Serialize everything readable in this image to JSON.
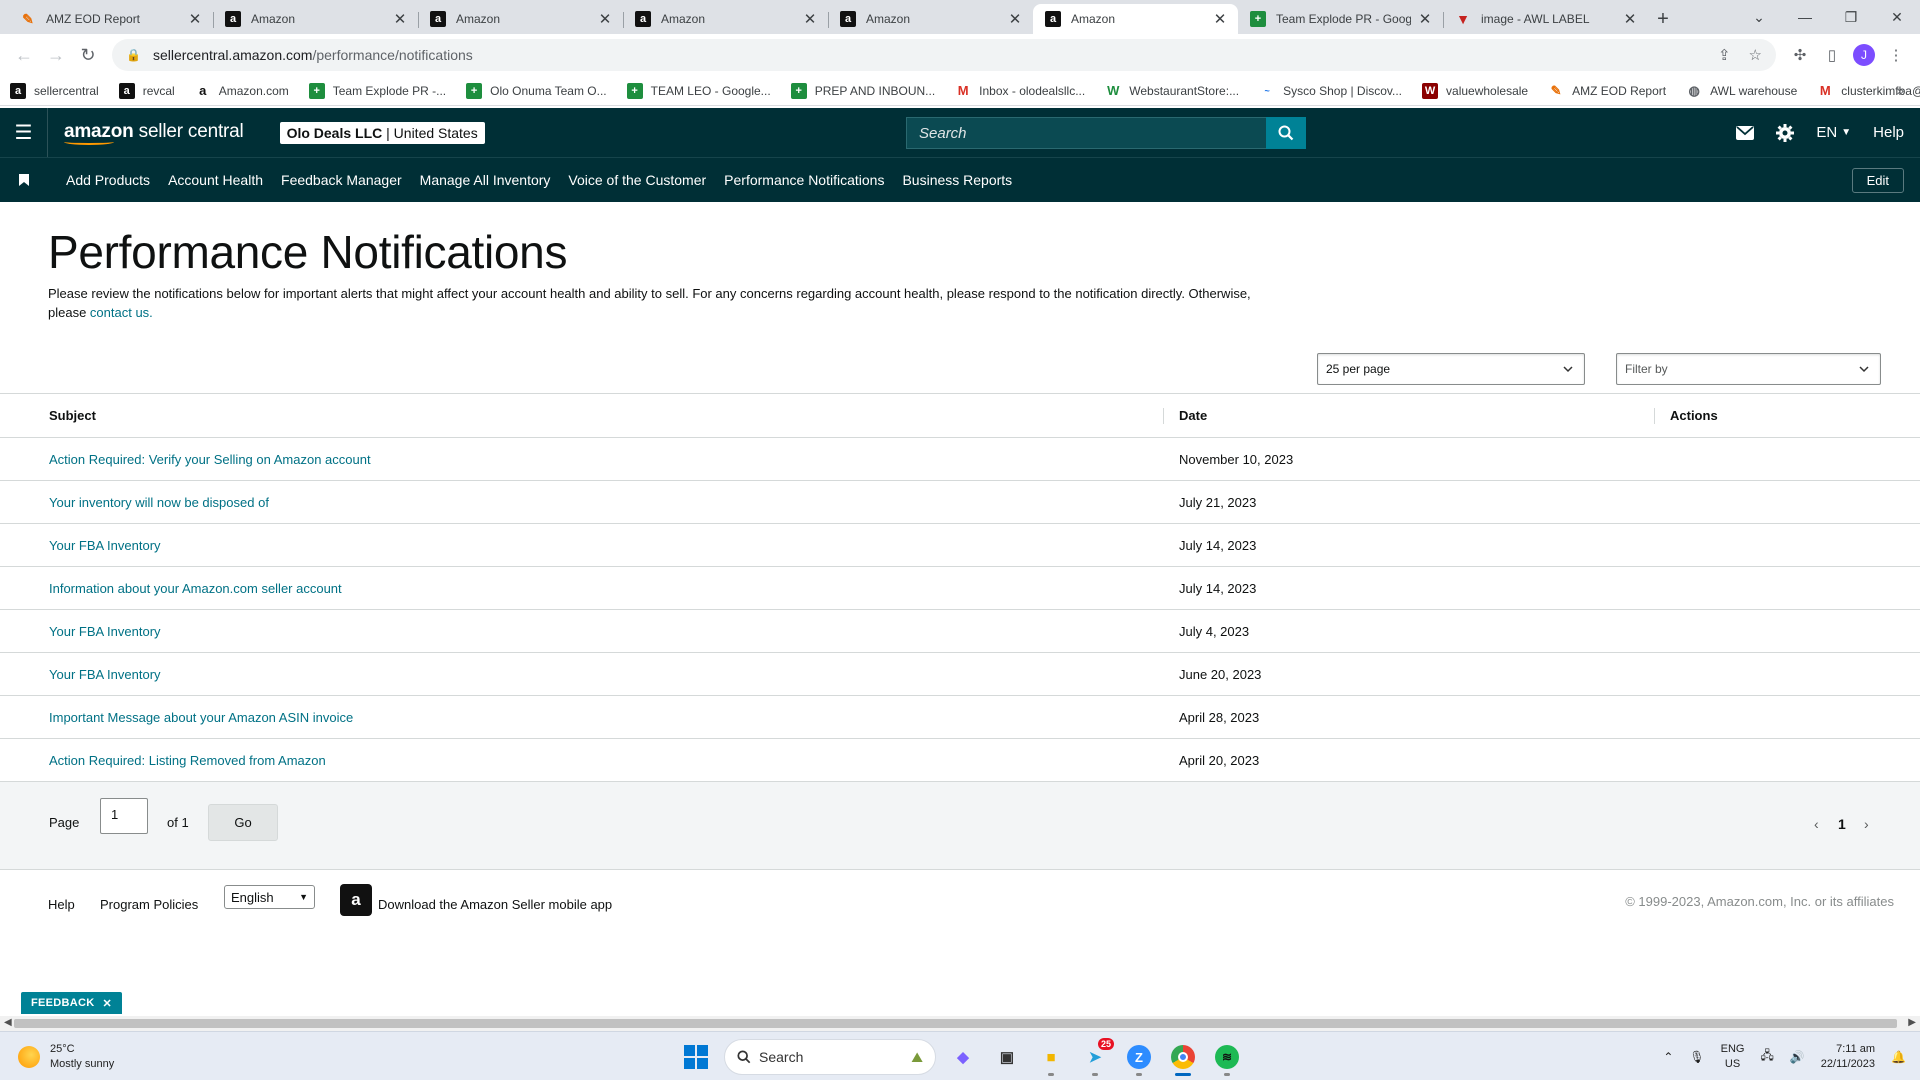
{
  "browser": {
    "tabs": [
      {
        "title": "AMZ EOD Report",
        "icon": "claude-icon",
        "active": false
      },
      {
        "title": "Amazon",
        "icon": "amazon-icon",
        "active": false
      },
      {
        "title": "Amazon",
        "icon": "amazon-icon",
        "active": false
      },
      {
        "title": "Amazon",
        "icon": "amazon-icon",
        "active": false
      },
      {
        "title": "Amazon",
        "icon": "amazon-icon",
        "active": false
      },
      {
        "title": "Amazon",
        "icon": "amazon-icon",
        "active": true
      },
      {
        "title": "Team Explode PR - Googl",
        "icon": "sheets-icon",
        "active": false
      },
      {
        "title": "image - AWL LABEL",
        "icon": "dogs-icon",
        "active": false
      }
    ],
    "url_host": "sellercentral.amazon.com",
    "url_path": "/performance/notifications",
    "profile_initial": "J",
    "bookmarks": [
      {
        "label": "sellercentral",
        "icon": "amazon-icon"
      },
      {
        "label": "revcal",
        "icon": "amazon-icon"
      },
      {
        "label": "Amazon.com",
        "icon": "amazon-smile-icon"
      },
      {
        "label": "Team Explode PR -...",
        "icon": "sheets-icon"
      },
      {
        "label": "Olo Onuma Team O...",
        "icon": "sheets-icon"
      },
      {
        "label": "TEAM LEO - Google...",
        "icon": "sheets-icon"
      },
      {
        "label": "PREP AND INBOUN...",
        "icon": "sheets-icon"
      },
      {
        "label": "Inbox - olodealsllc...",
        "icon": "gmail-icon"
      },
      {
        "label": "WebstaurantStore:...",
        "icon": "webstaurant-icon"
      },
      {
        "label": "Sysco Shop | Discov...",
        "icon": "sysco-icon"
      },
      {
        "label": "valuewholesale",
        "icon": "valuewholesale-icon"
      },
      {
        "label": "AMZ EOD Report",
        "icon": "claude-icon"
      },
      {
        "label": "AWL warehouse",
        "icon": "globe-icon"
      },
      {
        "label": "clusterkimfba@gm...",
        "icon": "gmail-icon"
      }
    ]
  },
  "header": {
    "logo_brand": "amazon",
    "logo_product": "seller central",
    "account_name": "Olo Deals LLC",
    "account_marketplace": "United States",
    "search_placeholder": "Search",
    "language": "EN",
    "help": "Help"
  },
  "nav": {
    "items": [
      "Add Products",
      "Account Health",
      "Feedback Manager",
      "Manage All Inventory",
      "Voice of the Customer",
      "Performance Notifications",
      "Business Reports"
    ],
    "edit_label": "Edit"
  },
  "page": {
    "title": "Performance Notifications",
    "description": "Please review the notifications below for important alerts that might affect your account health and ability to sell. For any concerns regarding account health, please respond to the notification directly. Otherwise, please ",
    "contact_link": "contact us.",
    "per_page": "25 per page",
    "filter_placeholder": "Filter by"
  },
  "table": {
    "columns": {
      "subject": "Subject",
      "date": "Date",
      "actions": "Actions"
    },
    "rows": [
      {
        "subject": "Action Required: Verify your Selling on Amazon account",
        "date": "November 10, 2023"
      },
      {
        "subject": "Your inventory will now be disposed of",
        "date": "July 21, 2023"
      },
      {
        "subject": "Your FBA Inventory",
        "date": "July 14, 2023"
      },
      {
        "subject": "Information about your Amazon.com seller account",
        "date": "July 14, 2023"
      },
      {
        "subject": "Your FBA Inventory",
        "date": "July 4, 2023"
      },
      {
        "subject": "Your FBA Inventory",
        "date": "June 20, 2023"
      },
      {
        "subject": "Important Message about your Amazon ASIN invoice",
        "date": "April 28, 2023"
      },
      {
        "subject": "Action Required: Listing Removed from Amazon",
        "date": "April 20, 2023"
      }
    ]
  },
  "pagination": {
    "page_label": "Page",
    "current_page": "1",
    "of_label": "of 1",
    "go_label": "Go",
    "page_number": "1"
  },
  "footer": {
    "help": "Help",
    "program_policies": "Program Policies",
    "language": "English",
    "app_text": "Download the Amazon Seller mobile app",
    "copyright": "© 1999-2023, Amazon.com, Inc. or its affiliates"
  },
  "feedback_label": "FEEDBACK",
  "taskbar": {
    "temperature": "25°C",
    "weather": "Mostly sunny",
    "search": "Search",
    "telegram_badge": "25",
    "lang_top": "ENG",
    "lang_bottom": "US",
    "time": "7:11 am",
    "date": "22/11/2023"
  },
  "colors": {
    "header_bg": "#002f36",
    "link": "#007185",
    "search_button": "#008296",
    "feedback": "#008296"
  }
}
